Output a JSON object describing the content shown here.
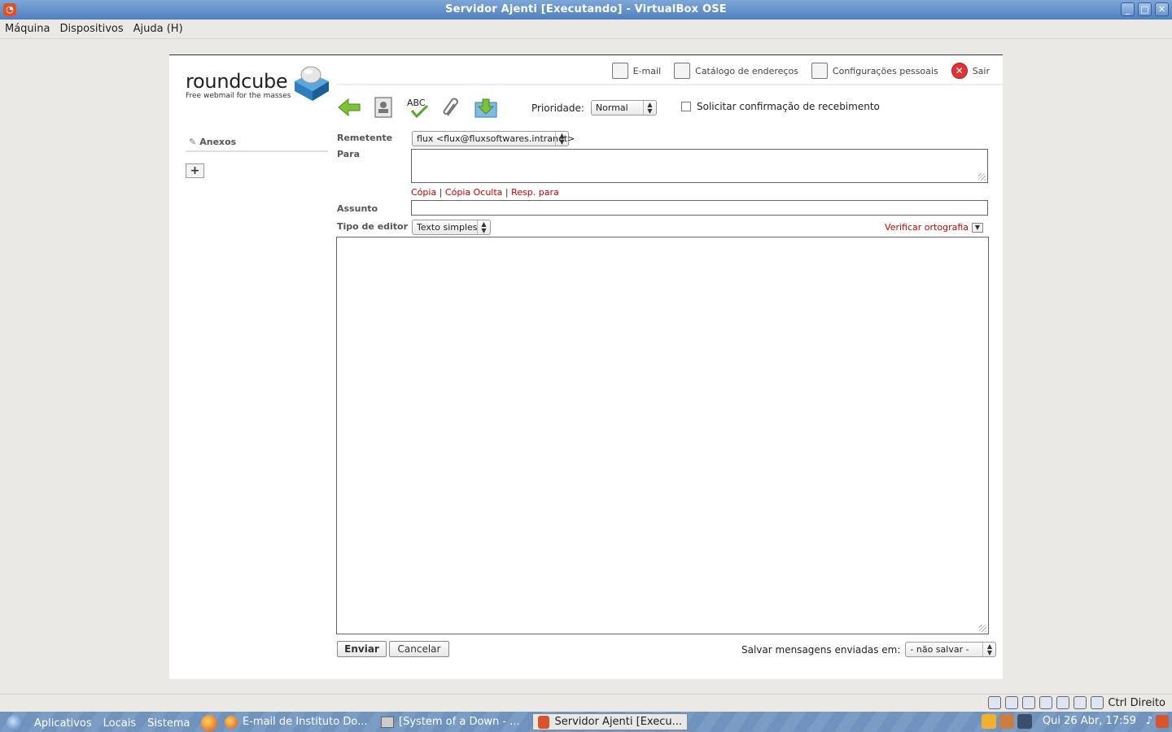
{
  "window": {
    "title": "Servidor Ajenti [Executando] - VirtualBox OSE",
    "buttons": {
      "minimize": "_",
      "maximize": "□",
      "close": "✕"
    }
  },
  "vbox_menu": [
    "Máquina",
    "Dispositivos",
    "Ajuda (H)"
  ],
  "roundcube": {
    "logo_word": "roundcube",
    "logo_tagline": "Free webmail for the masses",
    "nav": {
      "email": "E-mail",
      "addressbook": "Catálogo de endereços",
      "settings": "Configurações pessoais",
      "logout": "Sair"
    },
    "toolbar_icons": [
      "back-arrow-icon",
      "addressbook-icon",
      "spellcheck-icon",
      "attachment-icon",
      "save-draft-icon"
    ],
    "priority_label": "Prioridade:",
    "priority_value": "Normal",
    "receipt_label": "Solicitar confirmação de recebimento",
    "attachments_label": "Anexos",
    "add_attachment": "+",
    "form": {
      "from_label": "Remetente",
      "from_value": "flux <flux@fluxsoftwares.intranet>",
      "to_label": "Para",
      "to_value": "",
      "cc_link": "Cópia",
      "bcc_link": "Cópia Oculta",
      "replyto_link": "Resp. para",
      "separator": "|",
      "subject_label": "Assunto",
      "subject_value": "",
      "editor_label": "Tipo de editor",
      "editor_value": "Texto simples",
      "spellcheck_link": "Verificar ortografia",
      "body_value": ""
    },
    "send_button": "Enviar",
    "cancel_button": "Cancelar",
    "save_sent_label": "Salvar mensagens enviadas em:",
    "save_sent_value": "- não salvar -"
  },
  "statusbar": {
    "host_key": "Ctrl Direito"
  },
  "panel": {
    "menus": [
      "Aplicativos",
      "Locais",
      "Sistema"
    ],
    "tasks": [
      "E-mail de Instituto Do...",
      "[System of a Down - ...",
      "Servidor Ajenti [Execu..."
    ],
    "clock": "Qui 26 Abr, 17:59"
  },
  "colors": {
    "link_red": "#cc0000",
    "titlebar_blue": "#4f7fbf"
  }
}
